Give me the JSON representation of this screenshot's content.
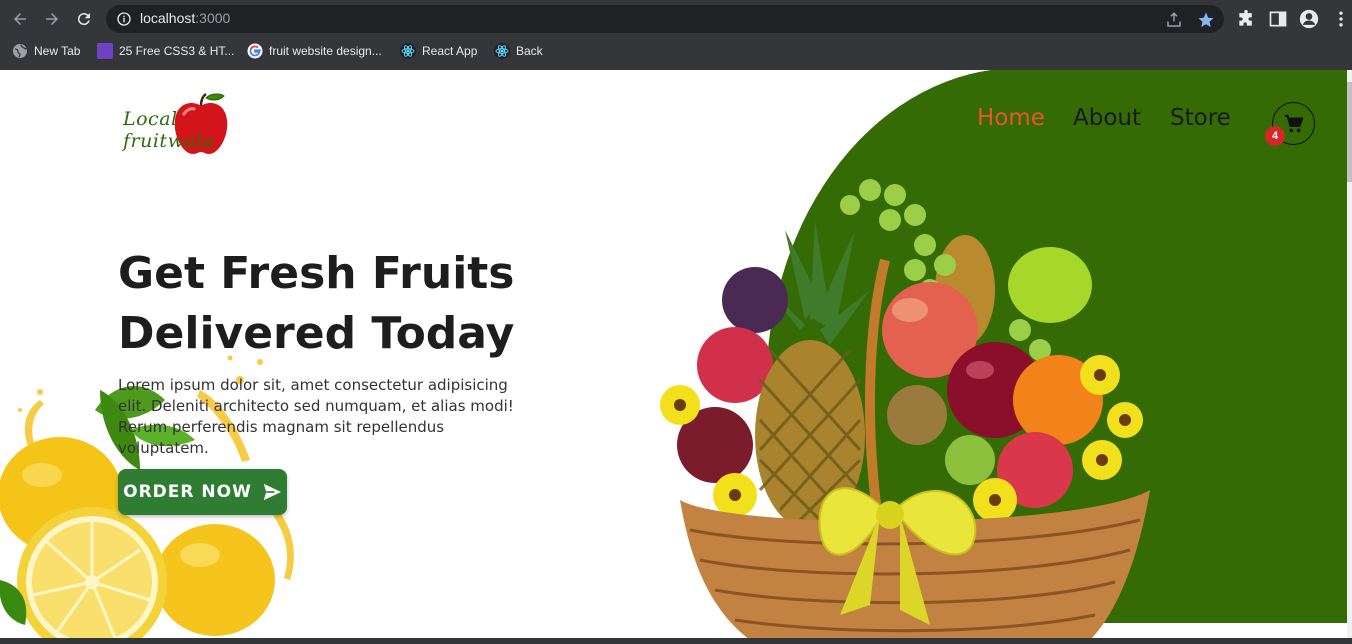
{
  "browser": {
    "url_host": "localhost",
    "url_port": ":3000",
    "bookmarks": [
      {
        "label": "New Tab",
        "icon": "globe-icon"
      },
      {
        "label": "25 Free CSS3 & HT...",
        "icon": "colorlib-icon"
      },
      {
        "label": "fruit website design...",
        "icon": "google-icon"
      },
      {
        "label": "React App",
        "icon": "react-icon"
      },
      {
        "label": "Back",
        "icon": "react-icon"
      }
    ]
  },
  "header": {
    "logo_line1": "Local",
    "logo_line2": "fruitwala",
    "nav": [
      {
        "label": "Home",
        "active": true
      },
      {
        "label": "About",
        "active": false
      },
      {
        "label": "Store",
        "active": false
      }
    ],
    "cart_count": "4"
  },
  "hero": {
    "title_line1": "Get Fresh Fruits",
    "title_line2": "Delivered Today",
    "description": "Lorem ipsum dolor sit, amet consectetur adipisicing elit. Deleniti architecto sed numquam, et alias modi! Rerum perferendis magnam sit repellendus voluptatem.",
    "cta_label": "ORDER NOW"
  },
  "colors": {
    "accent_green": "#356b04",
    "button_green": "#2e7d32",
    "nav_active": "#e8542d",
    "badge_red": "#d6262a"
  }
}
